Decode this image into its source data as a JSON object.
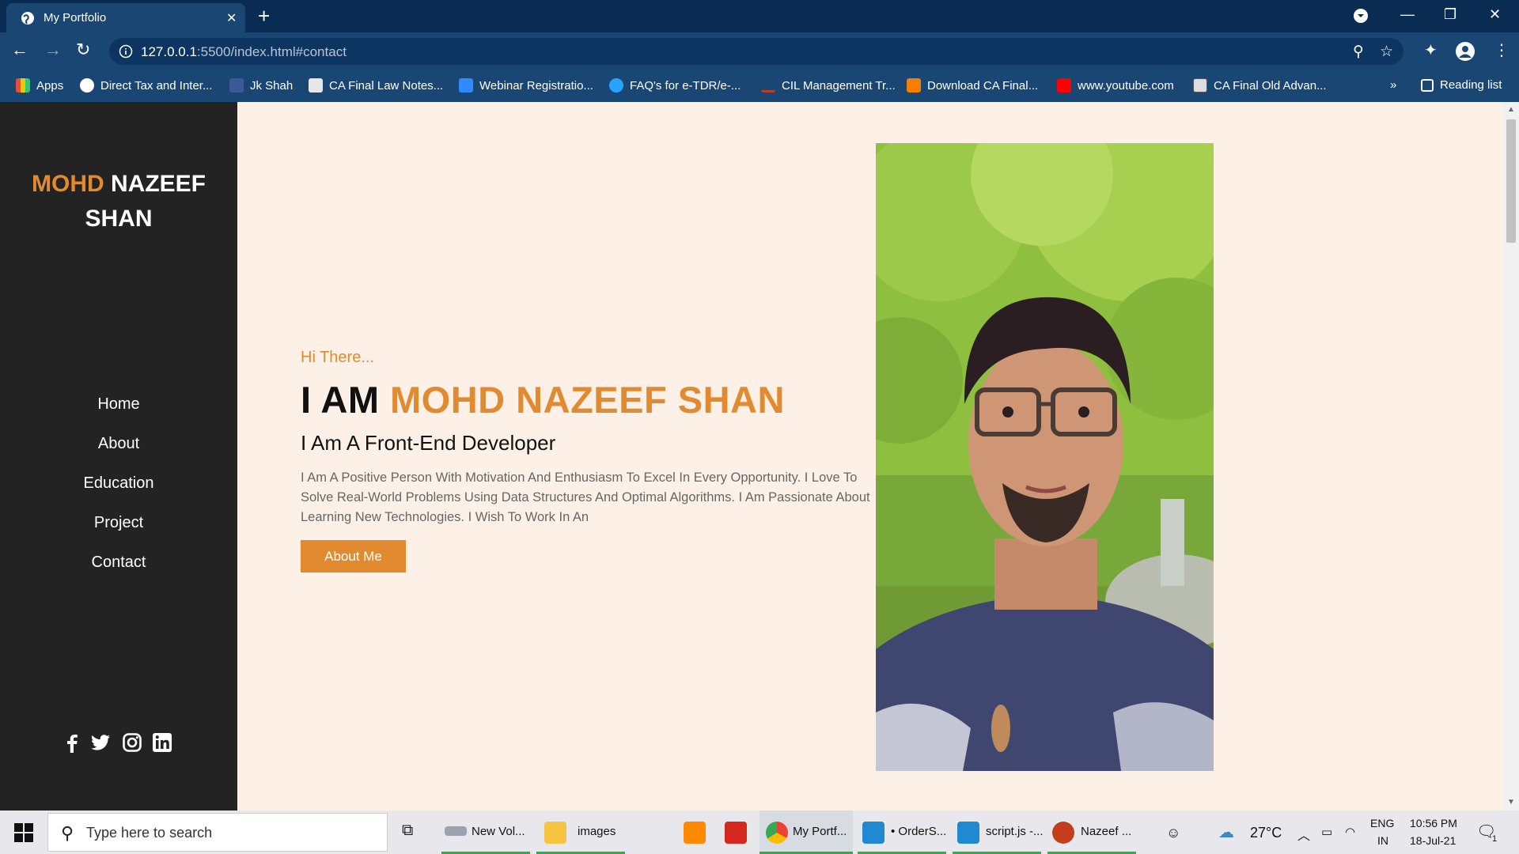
{
  "browser": {
    "tab_title": "My Portfolio",
    "url_host": "127.0.0.1",
    "url_rest": ":5500/index.html#contact",
    "bookmarks": [
      "Apps",
      "Direct Tax and Inter...",
      "Jk Shah",
      "CA Final Law Notes...",
      "Webinar Registratio...",
      "FAQ's for e-TDR/e-...",
      "CIL Management Tr...",
      "Download CA Final...",
      "www.youtube.com",
      "CA Final Old Advan..."
    ],
    "more_bookmarks": "»",
    "reading_list": "Reading list"
  },
  "sidebar": {
    "brand_first": "MOHD",
    "brand_rest": " NAZEEF",
    "brand_last": "SHAN",
    "nav": [
      "Home",
      "About",
      "Education",
      "Project",
      "Contact"
    ]
  },
  "hero": {
    "greeting": "Hi There...",
    "iam": "I AM ",
    "name": "MOHD NAZEEF SHAN",
    "role": "I Am A Front-End Developer",
    "description": "I Am A Positive Person With Motivation And Enthusiasm To Excel In Every Opportunity. I Love To Solve Real-World Problems Using Data Structures And Optimal Algorithms. I Am Passionate About Learning New Technologies. I Wish To Work In An",
    "button": "About Me"
  },
  "taskbar": {
    "search_placeholder": "Type here to search",
    "apps": [
      "New Vol...",
      "images",
      "My Portf...",
      "• OrderS...",
      "script.js -...",
      "Nazeef ..."
    ],
    "weather": "27°C",
    "lang_top": "ENG",
    "lang_bottom": "IN",
    "time": "10:56 PM",
    "date": "18-Jul-21",
    "notif_count": "1"
  },
  "colors": {
    "accent": "#e28a2f",
    "sidebar_bg": "#232323",
    "page_bg": "#fdf1e7",
    "chrome_frame": "#0b2c52",
    "chrome_toolbar": "#1a4674"
  }
}
